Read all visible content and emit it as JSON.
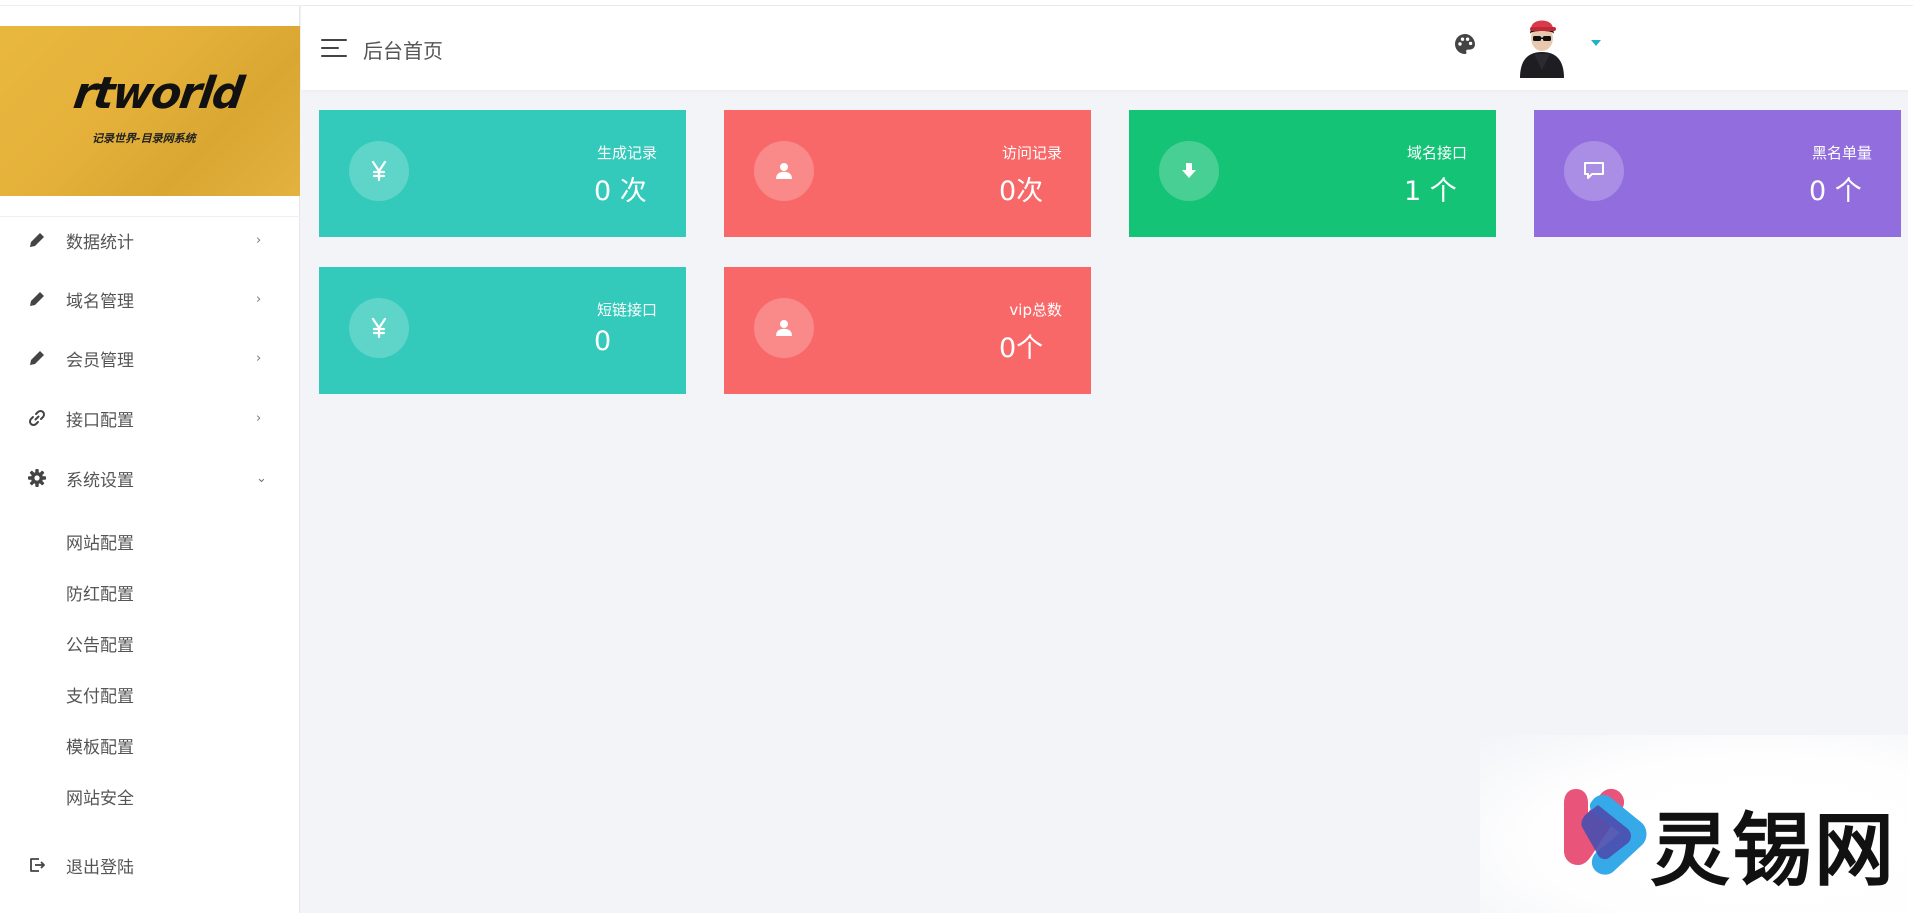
{
  "brand": {
    "logo_text": "rtworld",
    "logo_subtitle": "记录世界-目录网系统"
  },
  "header": {
    "title": "后台首页",
    "menu_icon": "hamburger-icon",
    "theme_icon": "palette-icon",
    "avatar_icon": "user-avatar",
    "accent": "#21b2c6"
  },
  "sidebar": {
    "items": [
      {
        "label": "数据统计",
        "icon": "pencil-icon",
        "caret": "›"
      },
      {
        "label": "域名管理",
        "icon": "pencil-icon",
        "caret": "›"
      },
      {
        "label": "会员管理",
        "icon": "pencil-icon",
        "caret": "›"
      },
      {
        "label": "接口配置",
        "icon": "link-icon",
        "caret": "›"
      },
      {
        "label": "系统设置",
        "icon": "gear-icon",
        "caret": "⌄"
      }
    ],
    "sub_items": [
      "网站配置",
      "防红配置",
      "公告配置",
      "支付配置",
      "模板配置",
      "网站安全"
    ],
    "logout": {
      "label": "退出登陆",
      "icon": "logout-icon"
    }
  },
  "cards": [
    {
      "title": "生成记录",
      "value": "0 次",
      "icon": "yen-icon",
      "color": "#33cabb"
    },
    {
      "title": "访问记录",
      "value": "0次",
      "icon": "user-icon",
      "color": "#f96868"
    },
    {
      "title": "域名接口",
      "value": "1 个",
      "icon": "download-icon",
      "color": "#15c377"
    },
    {
      "title": "黑名单量",
      "value": "0 个",
      "icon": "comment-icon",
      "color": "#926dde"
    },
    {
      "title": "短链接口",
      "value": "0",
      "icon": "yen-icon",
      "color": "#33cabb"
    },
    {
      "title": "vip总数",
      "value": "0个",
      "icon": "user-icon",
      "color": "#f96868"
    }
  ],
  "watermark": {
    "text": "灵锡网"
  }
}
